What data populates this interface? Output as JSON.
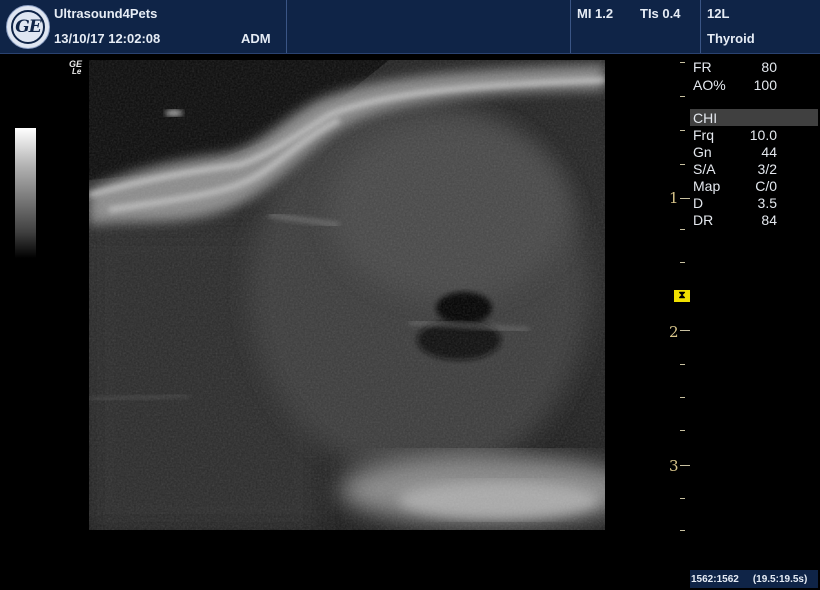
{
  "header": {
    "site": "Ultrasound4Pets",
    "datetime": "13/10/17 12:02:08",
    "operator": "ADM",
    "mi": "MI 1.2",
    "tis": "TIs 0.4",
    "probe": "12L",
    "preset": "Thyroid"
  },
  "logo": {
    "text": "GE"
  },
  "image_mark": {
    "line1": "GE",
    "line2": "Le"
  },
  "depth_scale": {
    "labels": [
      "1",
      "2",
      "3"
    ]
  },
  "params": [
    {
      "key": "FR",
      "value": "80"
    },
    {
      "key": "AO%",
      "value": "100"
    },
    {
      "key": "Frq",
      "value": "10.0"
    },
    {
      "key": "Gn",
      "value": "44"
    },
    {
      "key": "S/A",
      "value": "3/2"
    },
    {
      "key": "Map",
      "value": "C/0"
    },
    {
      "key": "D",
      "value": "3.5"
    },
    {
      "key": "DR",
      "value": "84"
    }
  ],
  "mode_label": "CHI",
  "footer": {
    "frames": "1562:1562",
    "time": "(19.5:19.5s)"
  },
  "colors": {
    "header_bg": "#0f2447",
    "depth_scale": "#d8c58a",
    "focus_marker": "#f0e000"
  }
}
